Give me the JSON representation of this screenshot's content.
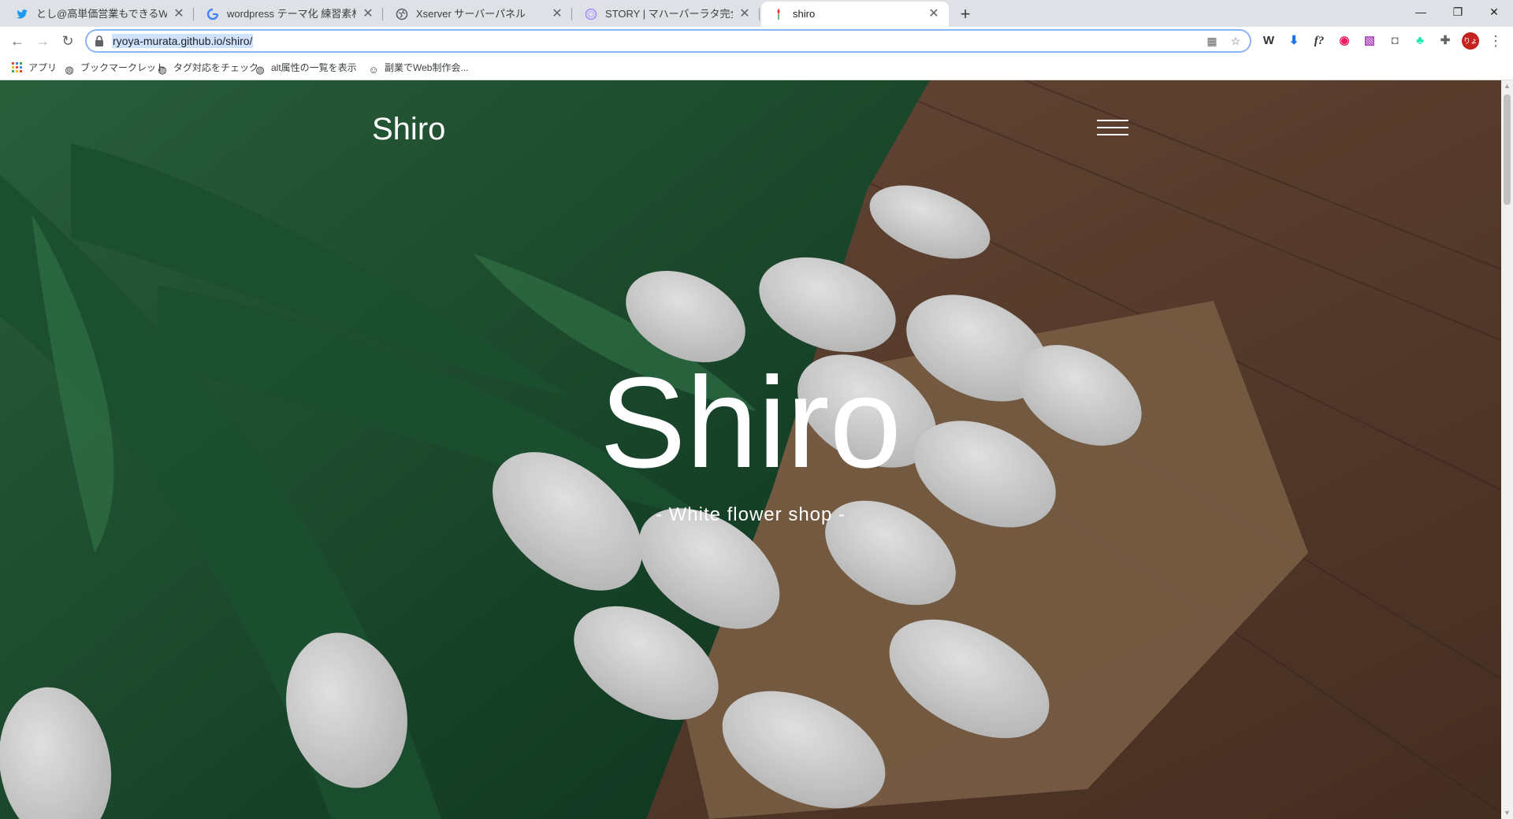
{
  "browser": {
    "tabs": [
      {
        "title": "とし@高単価営業もできるWebエン",
        "icon": "twitter-bird-icon"
      },
      {
        "title": "wordpress テーマ化 練習素材 - Go",
        "icon": "google-g-icon"
      },
      {
        "title": "Xserver サーバーパネル",
        "icon": "globe-icon"
      },
      {
        "title": "STORY | マハーバーラタ完全版",
        "icon": "spiral-icon"
      },
      {
        "title": "shiro",
        "icon": "flower-icon"
      }
    ],
    "active_tab_index": 4,
    "new_tab": "+",
    "address": "ryoya-murata.github.io/shiro/",
    "bookmarks": [
      {
        "label": "アプリ",
        "icon": "apps-grid-icon"
      },
      {
        "label": "ブックマークレット",
        "icon": "globe-icon"
      },
      {
        "label": "タグ対応をチェック",
        "icon": "globe-icon"
      },
      {
        "label": "alt属性の一覧を表示",
        "icon": "globe-icon"
      },
      {
        "label": "副業でWeb制作会...",
        "icon": "person-icon"
      }
    ],
    "extensions": [
      {
        "name": "w-extension-icon",
        "glyph": "W"
      },
      {
        "name": "download-extension-icon",
        "glyph": "⬇"
      },
      {
        "name": "whatfont-extension-icon",
        "glyph": "f?"
      },
      {
        "name": "color-wheel-extension-icon",
        "glyph": "◉"
      },
      {
        "name": "gradient-extension-icon",
        "glyph": "▧"
      },
      {
        "name": "camera-extension-icon",
        "glyph": "◘"
      },
      {
        "name": "tree-extension-icon",
        "glyph": "♣"
      },
      {
        "name": "puzzle-extensions-icon",
        "glyph": "✚"
      }
    ],
    "profile_initials": "りょ",
    "colors": {
      "accent_blue": "#8ab4f8",
      "profile": "#c5221f"
    }
  },
  "page": {
    "logo": "Shiro",
    "hero_title": "Shiro",
    "hero_subtitle": "- White flower shop -"
  }
}
